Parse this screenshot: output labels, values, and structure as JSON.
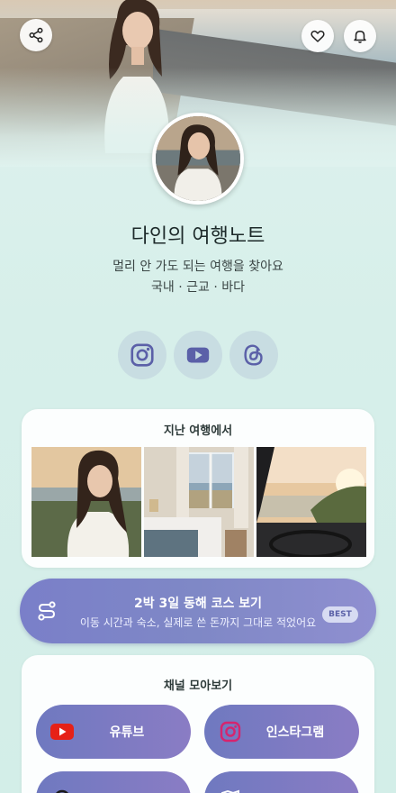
{
  "profile": {
    "title": "다인의 여행노트",
    "subtitle": "멀리 안 가도 되는 여행을 찾아요",
    "tags": "국내 · 근교 · 바다"
  },
  "header": {
    "share_icon": "share-icon",
    "heart_icon": "heart-icon",
    "bell_icon": "bell-icon"
  },
  "social": [
    {
      "name": "instagram-icon"
    },
    {
      "name": "youtube-icon"
    },
    {
      "name": "threads-icon"
    }
  ],
  "recent_trips": {
    "title": "지난 여행에서",
    "photos": [
      "portrait-seaside",
      "hotel-room-ocean-view",
      "car-window-sunset"
    ]
  },
  "course": {
    "title": "2박 3일 동해 코스 보기",
    "subtitle": "이동 시간과 숙소, 실제로 쓴 돈까지 그대로 적었어요",
    "badge": "BEST"
  },
  "channels": {
    "title": "채널 모아보기",
    "items": [
      {
        "label": "유튜브",
        "icon": "youtube-icon"
      },
      {
        "label": "인스타그램",
        "icon": "instagram-icon"
      }
    ]
  },
  "colors": {
    "accent": "#7a7fc9",
    "background": "#dff2ee",
    "youtube_red": "#e62117",
    "instagram_pink": "#d6246e"
  }
}
